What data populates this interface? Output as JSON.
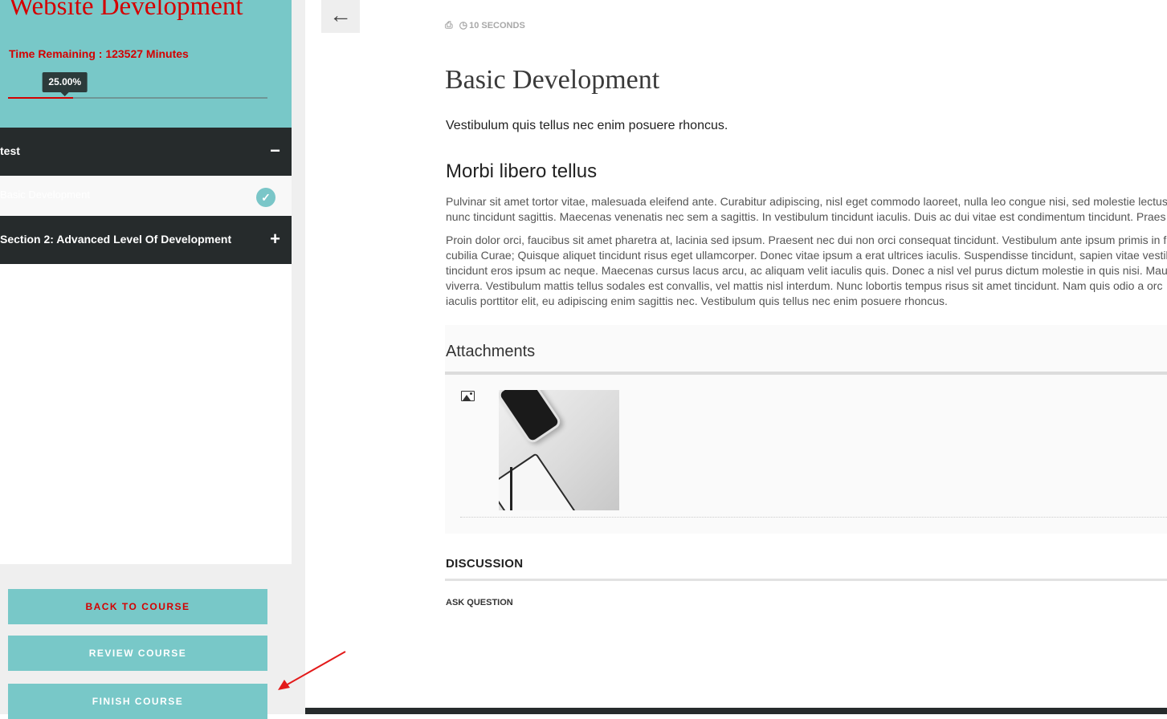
{
  "sidebar": {
    "course_title": "Website Development",
    "time_remaining": "Time Remaining : 123527 Minutes",
    "progress": {
      "label": "25.00%",
      "value": 0.25
    },
    "sections": [
      {
        "title": "test",
        "toggle": "−",
        "expanded": true,
        "lessons": [
          {
            "title": "Basic Development",
            "completed": true
          }
        ]
      },
      {
        "title": "Section 2: Advanced Level Of Development",
        "toggle": "+",
        "expanded": false
      }
    ],
    "buttons": {
      "back": "BACK TO COURSE",
      "review": "REVIEW COURSE",
      "finish": "FINISH COURSE"
    }
  },
  "colors": {
    "accent": "#78c8c8",
    "title_red": "#d40000",
    "dark_bar": "#262b2c"
  },
  "main": {
    "meta": {
      "duration": "10 SECONDS"
    },
    "title": "Basic Development",
    "lead": "Vestibulum quis tellus nec enim posuere rhoncus.",
    "subheading": "Morbi libero tellus",
    "paragraph1_lines": [
      "Pulvinar sit amet tortor vitae, malesuada eleifend ante. Curabitur adipiscing, nisl eget commodo laoreet, nulla leo congue nisi, sed molestie lectus",
      "nunc tincidunt sagittis. Maecenas venenatis nec sem a sagittis. In vestibulum tincidunt iaculis. Duis ac dui vitae est condimentum tincidunt. Praes"
    ],
    "paragraph2_lines": [
      "Proin dolor orci, faucibus sit amet pharetra at, lacinia sed ipsum. Praesent nec dui non orci consequat tincidunt. Vestibulum ante ipsum primis in f",
      "cubilia Curae; Quisque aliquet tincidunt risus eget ullamcorper. Donec vitae ipsum a erat ultrices iaculis. Suspendisse tincidunt, sapien vitae vestib",
      "tincidunt eros ipsum ac neque. Maecenas cursus lacus arcu, ac aliquam velit iaculis quis. Donec a nisl vel purus dictum molestie in quis nisi. Mau",
      "viverra. Vestibulum mattis tellus sodales est convallis, vel mattis nisl interdum. Nunc lobortis tempus risus sit amet tincidunt. Nam quis odio a orc",
      "iaculis porttitor elit, eu adipiscing enim sagittis nec. Vestibulum quis tellus nec enim posuere rhoncus."
    ],
    "attachments": {
      "title": "Attachments"
    },
    "discussion": {
      "title": "DISCUSSION",
      "ask": "ASK QUESTION"
    }
  },
  "icons": {
    "back": "arrow-left-icon",
    "print": "printer-icon",
    "clock": "clock-icon",
    "collapse": "minus-icon",
    "expand": "plus-icon",
    "complete": "check-circle-icon",
    "attachment": "image-icon"
  }
}
